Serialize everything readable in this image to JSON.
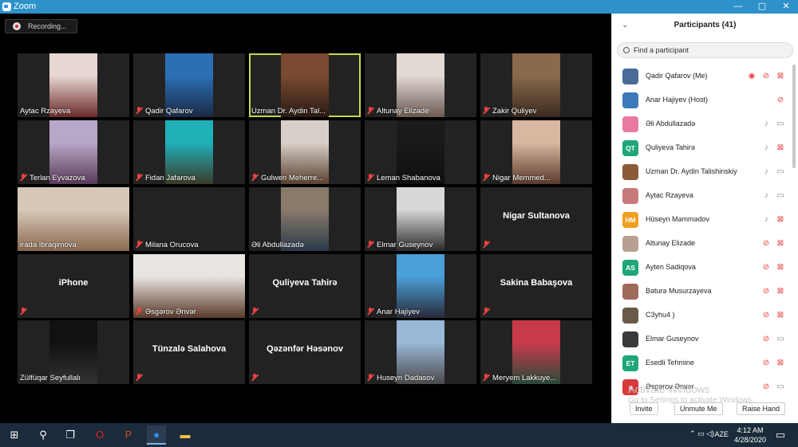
{
  "window": {
    "title": "Zoom",
    "minimize": "—",
    "maximize": "▢",
    "close": "✕"
  },
  "recording": {
    "label": "Recording..."
  },
  "tiles": [
    {
      "name": "Aytac Rzayeva",
      "muted": false,
      "kind": "photo",
      "c1": "#e8d6d2",
      "c2": "#6a2a2a"
    },
    {
      "name": "Qadir Qafarov",
      "muted": true,
      "kind": "photo",
      "c1": "#2b6fb5",
      "c2": "#1a2a44"
    },
    {
      "name": "Uzman Dr. Aydin Tal...",
      "muted": false,
      "kind": "photo",
      "c1": "#7a4a30",
      "c2": "#2a1a14",
      "active": true
    },
    {
      "name": "Altunay Elizade",
      "muted": true,
      "kind": "photo",
      "c1": "#e2d8d4",
      "c2": "#6b5a52"
    },
    {
      "name": "Zakir Quliyev",
      "muted": true,
      "kind": "photo",
      "c1": "#8a6a4a",
      "c2": "#3a2a20"
    },
    {
      "name": "Terlan Eyvazova",
      "muted": true,
      "kind": "photo",
      "c1": "#b8a8c8",
      "c2": "#5a3a5a"
    },
    {
      "name": "Fidan Jafarova",
      "muted": true,
      "kind": "photo",
      "c1": "#20b0b8",
      "c2": "#3a3a2a"
    },
    {
      "name": "Gulwen Meherre...",
      "muted": true,
      "kind": "photo",
      "c1": "#d8d0c8",
      "c2": "#5a4030"
    },
    {
      "name": "Leman Shabanova",
      "muted": true,
      "kind": "photo",
      "c1": "#1a1a1a",
      "c2": "#0f0f0f"
    },
    {
      "name": "Nigar Memmed...",
      "muted": true,
      "kind": "photo",
      "c1": "#d8b8a0",
      "c2": "#5a3a2a"
    },
    {
      "name": "irada Ibraqimova",
      "muted": false,
      "kind": "wide",
      "c1": "#d8c8b8",
      "c2": "#8a6a50"
    },
    {
      "name": "Milana Orucova",
      "muted": true,
      "kind": "blank",
      "c1": "#1a1a1a",
      "c2": "#1a1a1a"
    },
    {
      "name": "Əli Abdullazadə",
      "muted": false,
      "kind": "photo",
      "c1": "#8a7a6a",
      "c2": "#2a3a4a"
    },
    {
      "name": "Elmar Guseynov",
      "muted": true,
      "kind": "photo",
      "c1": "#d8d8d8",
      "c2": "#2a2a2a"
    },
    {
      "name": "",
      "muted": true,
      "kind": "text",
      "text": "Nigar Sultanova"
    },
    {
      "name": "",
      "muted": true,
      "kind": "text",
      "text": "iPhone"
    },
    {
      "name": "Əsgərov Ənvər",
      "muted": true,
      "kind": "wide",
      "c1": "#e8e4e0",
      "c2": "#5a3a2a"
    },
    {
      "name": "",
      "muted": true,
      "kind": "text",
      "text": "Quliyeva Tahirə"
    },
    {
      "name": "Anar Hajiyev",
      "muted": true,
      "kind": "photo",
      "c1": "#4aa0d8",
      "c2": "#2a2a3a"
    },
    {
      "name": "",
      "muted": true,
      "kind": "text",
      "text": "Sakina Babaşova"
    },
    {
      "name": "Zülfüqar Seyfullalı",
      "muted": false,
      "kind": "photo",
      "c1": "#111",
      "c2": "#333"
    },
    {
      "name": "",
      "muted": true,
      "kind": "text",
      "text": "Tünzalə Salahova"
    },
    {
      "name": "",
      "muted": true,
      "kind": "text",
      "text": "Qəzənfər Həsənov"
    },
    {
      "name": "Huseyn Dadasov",
      "muted": true,
      "kind": "photo",
      "c1": "#9ab8d8",
      "c2": "#4a4a4a"
    },
    {
      "name": "Meryem Lakkuye...",
      "muted": true,
      "kind": "photo",
      "c1": "#c83a4a",
      "c2": "#2a4a3a"
    }
  ],
  "panel": {
    "title": "Participants (41)",
    "search_placeholder": "Find a participant",
    "participants": [
      {
        "name": "Qadir Qafarov (Me)",
        "avatar": "",
        "color": "#4a6a9a",
        "rec": true,
        "mic": "off",
        "video": "off"
      },
      {
        "name": "Anar Hajiyev (Host)",
        "avatar": "",
        "color": "#3a7ab8",
        "rec": false,
        "mic": "off",
        "video": "none"
      },
      {
        "name": "Əli Abdullazadə",
        "avatar": "",
        "color": "#e87aa0",
        "rec": false,
        "mic": "on",
        "video": "on"
      },
      {
        "name": "Quliyeva Tahirə",
        "avatar": "QT",
        "color": "#1ea67a",
        "rec": false,
        "mic": "on",
        "video": "off"
      },
      {
        "name": "Uzman Dr. Aydin Talishinskiy",
        "avatar": "",
        "color": "#8a5a3a",
        "rec": false,
        "mic": "on",
        "video": "on"
      },
      {
        "name": "Aytac Rzayeva",
        "avatar": "",
        "color": "#c87a7a",
        "rec": false,
        "mic": "on",
        "video": "on"
      },
      {
        "name": "Hüseyn Məmmədov",
        "avatar": "HM",
        "color": "#f0a020",
        "rec": false,
        "mic": "on",
        "video": "off"
      },
      {
        "name": "Altunay Elizade",
        "avatar": "",
        "color": "#b8a090",
        "rec": false,
        "mic": "off",
        "video": "off"
      },
      {
        "name": "Ayten Sadiqova",
        "avatar": "AS",
        "color": "#1ea67a",
        "rec": false,
        "mic": "off",
        "video": "off"
      },
      {
        "name": "Bəturə Musurzayeva",
        "avatar": "",
        "color": "#a06a5a",
        "rec": false,
        "mic": "off",
        "video": "off"
      },
      {
        "name": "C3yhu4 )",
        "avatar": "",
        "color": "#6a5a4a",
        "rec": false,
        "mic": "off",
        "video": "off"
      },
      {
        "name": "Elmar Guseynov",
        "avatar": "",
        "color": "#3a3a3a",
        "rec": false,
        "mic": "off",
        "video": "on"
      },
      {
        "name": "Esedli Tehmine",
        "avatar": "ET",
        "color": "#1ea67a",
        "rec": false,
        "mic": "off",
        "video": "off"
      },
      {
        "name": "Əsgərov Ənvər",
        "avatar": "ə",
        "color": "#d83a3a",
        "rec": false,
        "mic": "off",
        "video": "on"
      }
    ],
    "watermark": "Activate Windows",
    "watermark_sub": "Go to Settings to activate Windows.",
    "buttons": {
      "invite": "Invite",
      "unmute": "Unmute Me",
      "raise": "Raise Hand"
    }
  },
  "taskbar": {
    "time": "4:12 AM",
    "date": "4/28/2020",
    "lang": "AZE"
  }
}
